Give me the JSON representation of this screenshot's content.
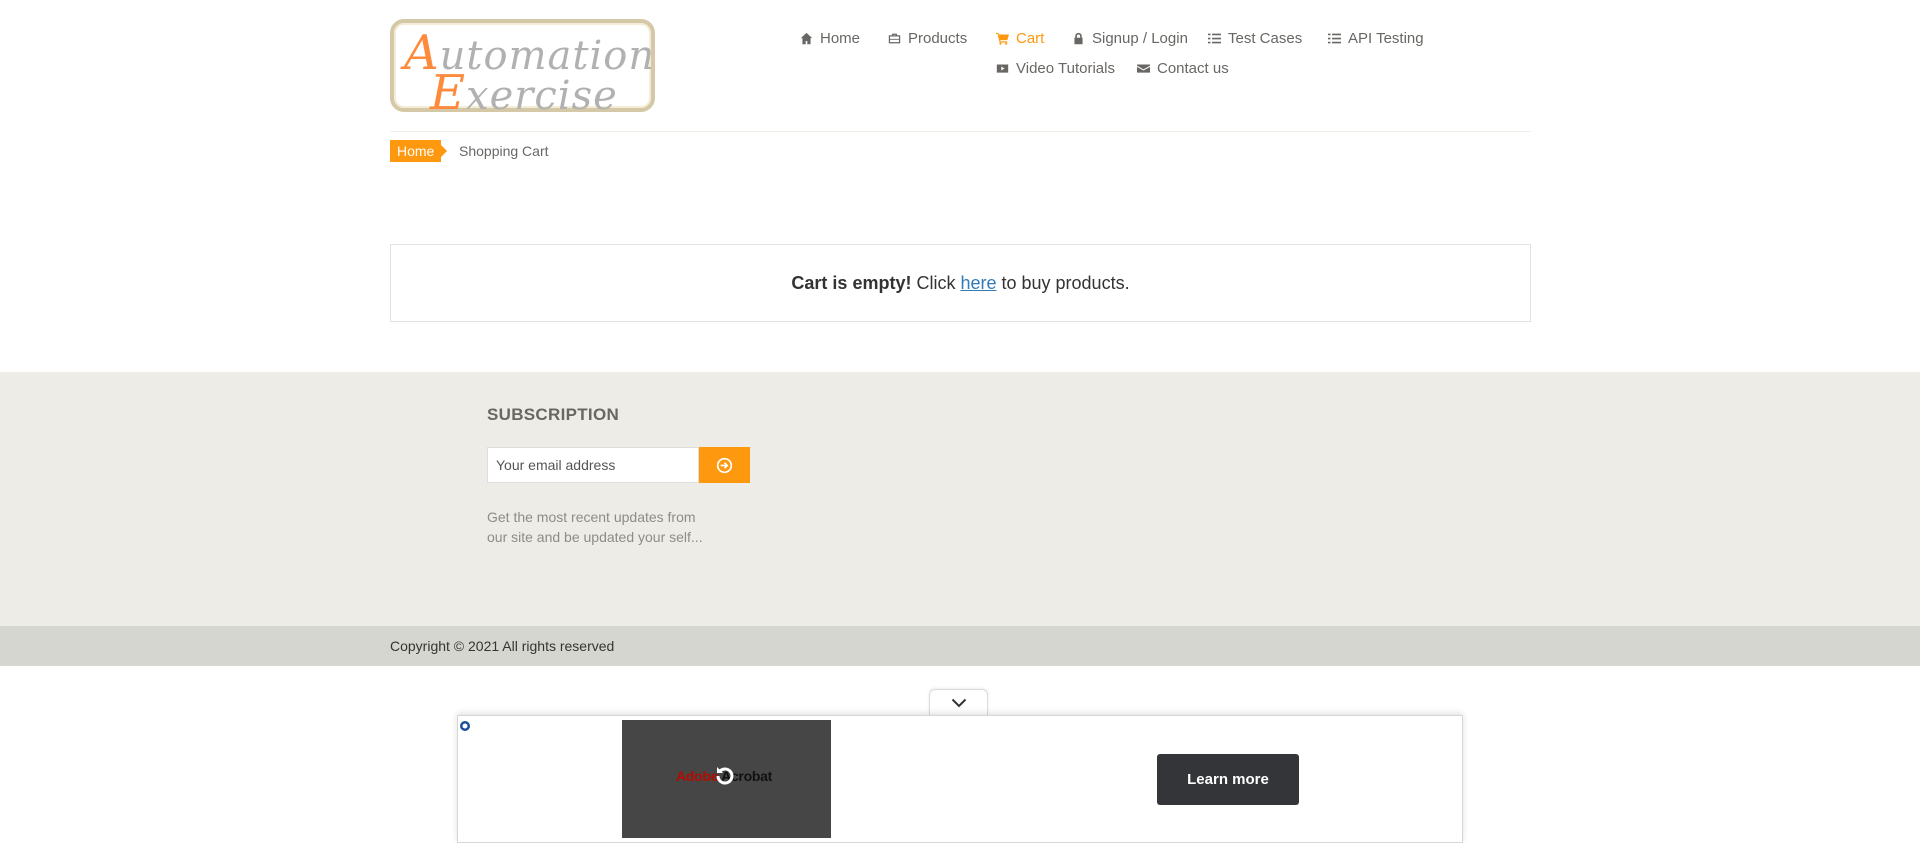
{
  "logo": {
    "line1_cap": "A",
    "line1_rest": "utomation",
    "line2_cap": "E",
    "line2_rest": "xercise"
  },
  "nav": {
    "items": [
      {
        "label": "Home",
        "icon": "home-icon",
        "active": false
      },
      {
        "label": "Products",
        "icon": "briefcase-icon",
        "active": false
      },
      {
        "label": "Cart",
        "icon": "cart-icon",
        "active": true
      },
      {
        "label": "Signup / Login",
        "icon": "lock-icon",
        "active": false
      },
      {
        "label": "Test Cases",
        "icon": "list-icon",
        "active": false
      },
      {
        "label": "API Testing",
        "icon": "list-icon",
        "active": false
      },
      {
        "label": "Video Tutorials",
        "icon": "youtube-play-icon",
        "active": false
      },
      {
        "label": "Contact us",
        "icon": "envelope-icon",
        "active": false
      }
    ]
  },
  "breadcrumb": {
    "home": "Home",
    "current": "Shopping Cart"
  },
  "cart": {
    "empty_bold": "Cart is empty!",
    "pre_link": "Click",
    "link": "here",
    "post_link": "to buy products."
  },
  "footer": {
    "subscription_title": "SUBSCRIPTION",
    "email_placeholder": "Your email address",
    "description": "Get the most recent updates from our site and be updated your self...",
    "copyright": "Copyright © 2021 All rights reserved"
  },
  "ad": {
    "brand_red": "Adobe",
    "brand_rest": " Acrobat",
    "cta": "Learn more"
  },
  "colors": {
    "accent": "#fe980f",
    "footer_bg": "#eeece6",
    "footer_bottom_bg": "#d6d6d0",
    "link": "#337ab7"
  }
}
